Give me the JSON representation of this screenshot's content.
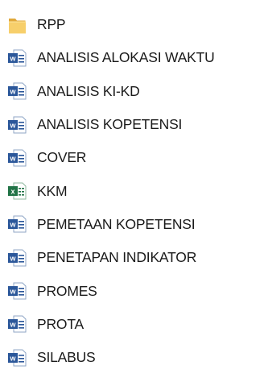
{
  "files": [
    {
      "name": "RPP",
      "type": "folder",
      "icon": "folder-icon",
      "color": "#F2C55C"
    },
    {
      "name": "ANALISIS ALOKASI WAKTU",
      "type": "word",
      "icon": "word-document-icon",
      "color": "#2B579A"
    },
    {
      "name": "ANALISIS KI-KD",
      "type": "word",
      "icon": "word-document-icon",
      "color": "#2B579A"
    },
    {
      "name": "ANALISIS KOPETENSI",
      "type": "word",
      "icon": "word-document-icon",
      "color": "#2B579A"
    },
    {
      "name": "COVER",
      "type": "word",
      "icon": "word-document-icon",
      "color": "#2B579A"
    },
    {
      "name": "KKM",
      "type": "excel",
      "icon": "excel-spreadsheet-icon",
      "color": "#217346"
    },
    {
      "name": "PEMETAAN KOPETENSI",
      "type": "word",
      "icon": "word-document-icon",
      "color": "#2B579A"
    },
    {
      "name": "PENETAPAN INDIKATOR",
      "type": "word",
      "icon": "word-document-icon",
      "color": "#2B579A"
    },
    {
      "name": "PROMES",
      "type": "word",
      "icon": "word-document-icon",
      "color": "#2B579A"
    },
    {
      "name": "PROTA",
      "type": "word",
      "icon": "word-document-icon",
      "color": "#2B579A"
    },
    {
      "name": "SILABUS",
      "type": "word",
      "icon": "word-document-icon",
      "color": "#2B579A"
    }
  ]
}
